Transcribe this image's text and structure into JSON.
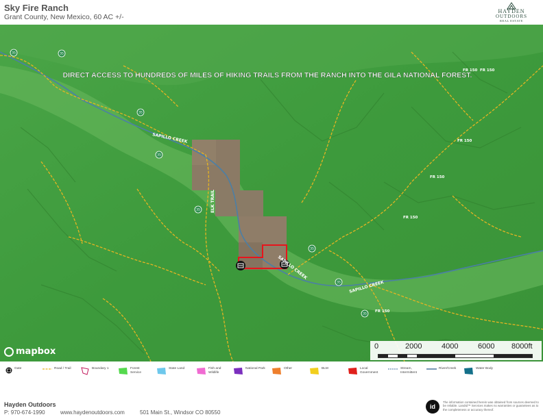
{
  "header": {
    "title": "Sky Fire Ranch",
    "subtitle": "Grant County, New Mexico, 60 AC +/-",
    "logo_line1": "HAYDEN",
    "logo_line2": "OUTDOORS",
    "logo_line3": "REAL ESTATE"
  },
  "map": {
    "banner": "DIRECT ACCESS TO HUNDREDS OF MILES OF HIKING TRAILS FROM THE RANCH INTO THE GILA NATIONAL FOREST.",
    "labels": {
      "creek_upper": "SAPILLO CREEK",
      "creek_right": "SAPILLO CREEK",
      "creek_mid": "SAPILLO CREEK",
      "elk_trail": "ELK TRAIL",
      "fr150_1": "FR 150",
      "fr150_2": "FR 150",
      "fr150_3": "FR 150",
      "fr150_4": "FR 150",
      "fr150_5": "FR 150",
      "fr150_6": "FR 150"
    },
    "route_shields": [
      "35",
      "35",
      "35",
      "35",
      "35",
      "35",
      "35",
      "35"
    ],
    "scale": {
      "ticks": [
        "0",
        "2000",
        "4000",
        "6000",
        "8000ft"
      ]
    },
    "attribution": "mapbox",
    "colors": {
      "forest": "#3f9a3b",
      "boundary": "#e8141b",
      "road": "#e6b422",
      "creek": "#4b7fa6"
    }
  },
  "legend": {
    "items": [
      {
        "label": "Gate",
        "symbol": "gate-icon",
        "color": "#111111"
      },
      {
        "label": "Road / Trail",
        "symbol": "road-line",
        "color": "#e6b422"
      },
      {
        "label": "Boundary 1",
        "symbol": "boundary-outline",
        "color": "#c2185b"
      },
      {
        "label": "Forest Service",
        "symbol": "polygon",
        "color": "#55d94e"
      },
      {
        "label": "State Land",
        "symbol": "polygon",
        "color": "#6ec8ec"
      },
      {
        "label": "Fish and Wildlife",
        "symbol": "polygon",
        "color": "#f06bd2"
      },
      {
        "label": "National Park",
        "symbol": "polygon",
        "color": "#7b2fbe"
      },
      {
        "label": "Other",
        "symbol": "polygon",
        "color": "#ee7f2d"
      },
      {
        "label": "BLM",
        "symbol": "polygon",
        "color": "#f2cf1e"
      },
      {
        "label": "Local Government",
        "symbol": "polygon",
        "color": "#e0201c"
      },
      {
        "label": "Stream, Intermittent",
        "symbol": "stream-line",
        "color": "#3f6c9b"
      },
      {
        "label": "River/Creek",
        "symbol": "river-line",
        "color": "#2f5f8f"
      },
      {
        "label": "Water Body",
        "symbol": "polygon",
        "color": "#14708a"
      }
    ]
  },
  "footer": {
    "company": "Hayden Outdoors",
    "phone": "P: 970-674-1990",
    "website": "www.haydenoutdoors.com",
    "address": "501 Main St., Windsor CO 80550",
    "badge": "id",
    "disclaimer": "The information contained herein was obtained from sources deemed to be reliable. LandId™ Services makes no warranties or guarantees as to the completeness or accuracy thereof."
  }
}
